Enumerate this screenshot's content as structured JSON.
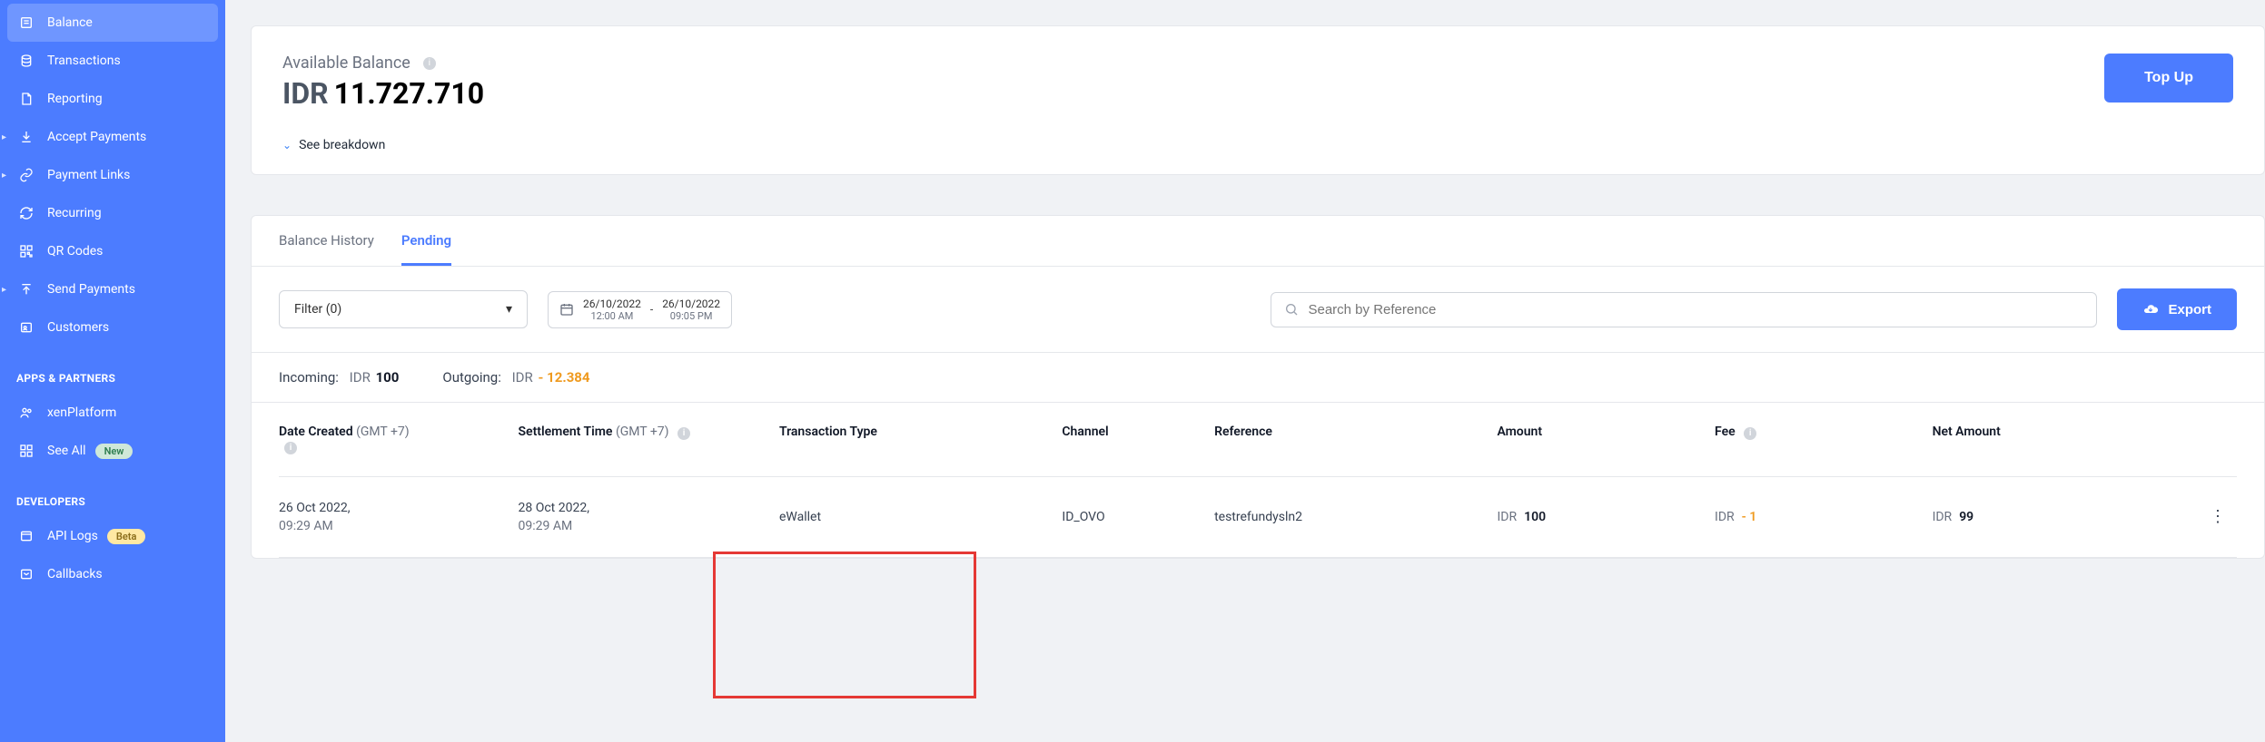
{
  "sidebar": {
    "items": [
      {
        "label": "Balance",
        "icon": "balance"
      },
      {
        "label": "Transactions",
        "icon": "transactions"
      },
      {
        "label": "Reporting",
        "icon": "reporting"
      },
      {
        "label": "Accept Payments",
        "icon": "accept",
        "expandable": true
      },
      {
        "label": "Payment Links",
        "icon": "links",
        "expandable": true
      },
      {
        "label": "Recurring",
        "icon": "recurring"
      },
      {
        "label": "QR Codes",
        "icon": "qr"
      },
      {
        "label": "Send Payments",
        "icon": "send",
        "expandable": true
      },
      {
        "label": "Customers",
        "icon": "customers"
      }
    ],
    "section_apps": "APPS & PARTNERS",
    "apps_items": [
      {
        "label": "xenPlatform",
        "icon": "xen"
      },
      {
        "label": "See All",
        "icon": "grid",
        "badge": "New",
        "badge_style": "green"
      }
    ],
    "section_dev": "DEVELOPERS",
    "dev_items": [
      {
        "label": "API Logs",
        "icon": "api",
        "badge": "Beta",
        "badge_style": "yellow"
      },
      {
        "label": "Callbacks",
        "icon": "callbacks"
      }
    ]
  },
  "balance": {
    "label": "Available Balance",
    "currency": "IDR",
    "value": "11.727.710",
    "breakdown": "See breakdown",
    "topup": "Top Up"
  },
  "tabs": {
    "history": "Balance History",
    "pending": "Pending",
    "active": "pending"
  },
  "toolbar": {
    "filter_label": "Filter (0)",
    "date_from": "26/10/2022",
    "date_from_time": "12:00 AM",
    "date_to": "26/10/2022",
    "date_to_time": "09:05 PM",
    "date_sep": "-",
    "search_placeholder": "Search by Reference",
    "export": "Export"
  },
  "summary": {
    "incoming_label": "Incoming:",
    "incoming_ccy": "IDR",
    "incoming_value": "100",
    "outgoing_label": "Outgoing:",
    "outgoing_ccy": "IDR",
    "outgoing_value": "- 12.384"
  },
  "table": {
    "headers": {
      "created": "Date Created",
      "created_tz": "(GMT +7)",
      "settlement": "Settlement Time",
      "settlement_tz": "(GMT +7)",
      "type": "Transaction Type",
      "channel": "Channel",
      "reference": "Reference",
      "amount": "Amount",
      "fee": "Fee",
      "net": "Net Amount"
    },
    "rows": [
      {
        "created_date": "26 Oct 2022,",
        "created_time": "09:29 AM",
        "settle_date": "28 Oct 2022,",
        "settle_time": "09:29 AM",
        "type": "eWallet",
        "channel": "ID_OVO",
        "reference": "testrefundysln2",
        "amount_ccy": "IDR",
        "amount": "100",
        "fee_ccy": "IDR",
        "fee": "- 1",
        "net_ccy": "IDR",
        "net": "99"
      }
    ]
  }
}
